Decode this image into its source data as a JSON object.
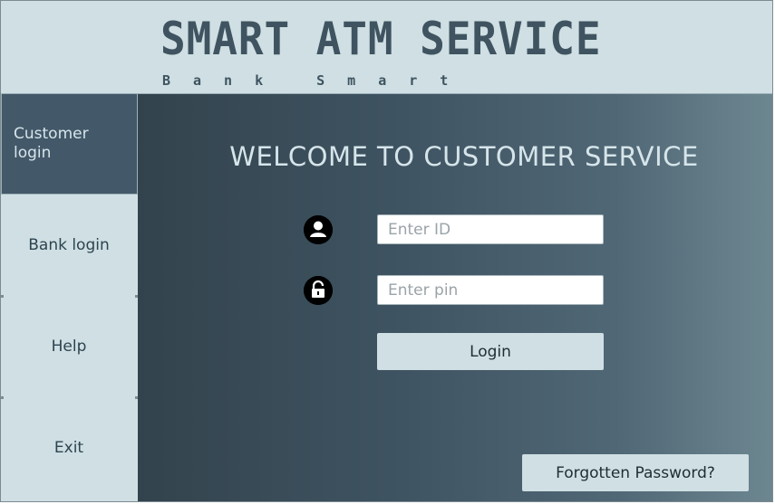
{
  "header": {
    "logo_title": "SMART ATM SERVICE",
    "logo_subtitle": "Bank Smart"
  },
  "sidebar": {
    "items": [
      {
        "label": "Customer login",
        "active": true
      },
      {
        "label": "Bank login",
        "active": false
      },
      {
        "label": "Help",
        "active": false
      },
      {
        "label": "Exit",
        "active": false
      }
    ]
  },
  "main": {
    "welcome": "WELCOME TO CUSTOMER SERVICE",
    "id_field": {
      "placeholder": "Enter ID",
      "value": "",
      "icon": "user-icon"
    },
    "pin_field": {
      "placeholder": "Enter pin",
      "value": "",
      "icon": "unlock-icon"
    },
    "login_label": "Login",
    "forgot_label": "Forgotten Password?"
  },
  "colors": {
    "sidebar_bg": "#cfdfe3",
    "active_item_bg": "#43596a",
    "main_gradient_start": "#33434d",
    "main_gradient_end": "#6d8791",
    "text_light": "#d6e5ea"
  }
}
